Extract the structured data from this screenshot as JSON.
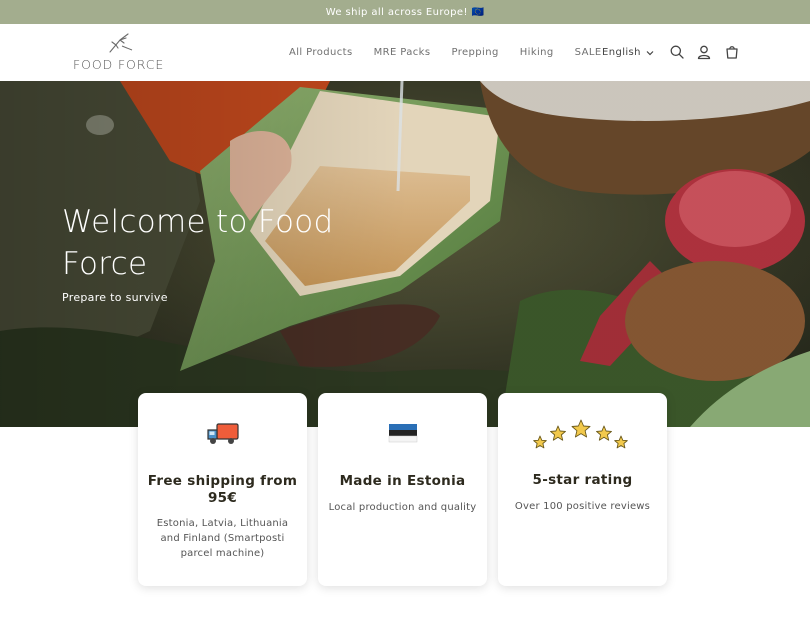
{
  "announcement": {
    "text": "We ship all across Europe! 🇪🇺"
  },
  "header": {
    "logo_text": "FOOD FORCE",
    "nav": [
      "All Products",
      "MRE Packs",
      "Prepping",
      "Hiking",
      "SALE"
    ],
    "language": "English",
    "icons": [
      "search-icon",
      "account-icon",
      "cart-icon"
    ]
  },
  "hero": {
    "title": "Welcome to Food Force",
    "subtitle": "Prepare to survive"
  },
  "features": [
    {
      "icon": "truck-icon",
      "title": "Free shipping from 95€",
      "text": "Estonia, Latvia, Lithuania and Finland (Smartposti parcel machine)"
    },
    {
      "icon": "estonia-flag-icon",
      "title": "Made in Estonia",
      "text": "Local production and quality"
    },
    {
      "icon": "stars-icon",
      "title": "5-star rating",
      "text": "Over 100 positive reviews"
    }
  ],
  "colors": {
    "announcement_bg": "#a3ad8e",
    "text_dark": "#2d2a1e",
    "flag_blue": "#2a6fb6"
  }
}
